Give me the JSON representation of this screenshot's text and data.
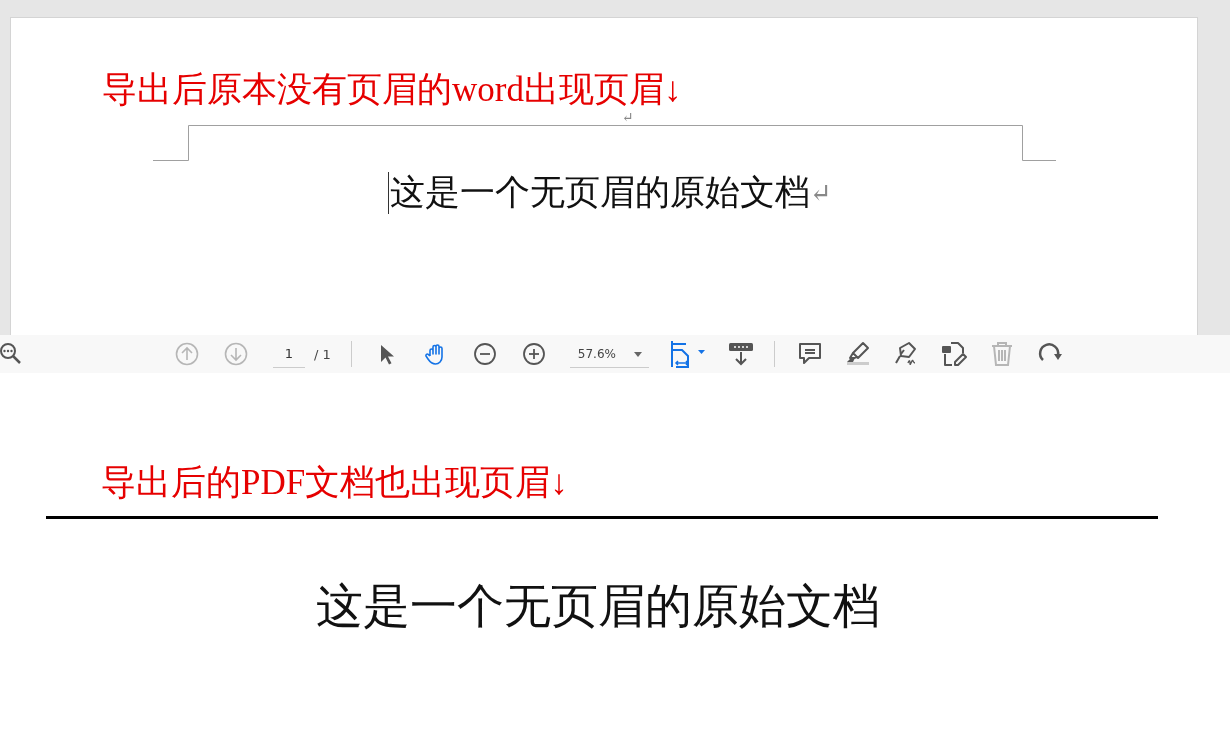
{
  "word_page": {
    "annotation": "导出后原本没有页眉的word出现页眉↓",
    "header_mark": "↵",
    "body": "这是一个无页眉的原始文档",
    "body_mark": "↵"
  },
  "toolbar": {
    "search_tool": {
      "kind": "search",
      "selected": false,
      "disabled": false
    },
    "nav_tools": [
      {
        "kind": "prev",
        "selected": false,
        "disabled": true
      },
      {
        "kind": "next",
        "selected": false,
        "disabled": true
      }
    ],
    "page_field": {
      "value": "1"
    },
    "page_total": "/ 1",
    "view_tools": [
      {
        "kind": "select",
        "selected": false,
        "disabled": false
      },
      {
        "kind": "hand",
        "selected": true,
        "disabled": false
      },
      {
        "kind": "zoom_out",
        "selected": false,
        "disabled": false
      },
      {
        "kind": "zoom_in",
        "selected": false,
        "disabled": false
      }
    ],
    "zoom_field": {
      "value": "57.6%"
    },
    "page_tools": [
      {
        "kind": "fit",
        "selected": true,
        "disabled": false
      },
      {
        "kind": "scroll",
        "selected": false,
        "disabled": false
      }
    ],
    "edit_tools": [
      {
        "kind": "comment",
        "selected": false,
        "disabled": false
      },
      {
        "kind": "highlight",
        "selected": false,
        "disabled": false
      },
      {
        "kind": "sign",
        "selected": false,
        "disabled": false
      },
      {
        "kind": "edit",
        "selected": false,
        "disabled": false
      },
      {
        "kind": "delete",
        "selected": false,
        "disabled": true
      },
      {
        "kind": "rotate",
        "selected": false,
        "disabled": false
      }
    ]
  },
  "pdf_page": {
    "annotation": "导出后的PDF文档也出现页眉↓",
    "body": "这是一个无页眉的原始文档"
  }
}
